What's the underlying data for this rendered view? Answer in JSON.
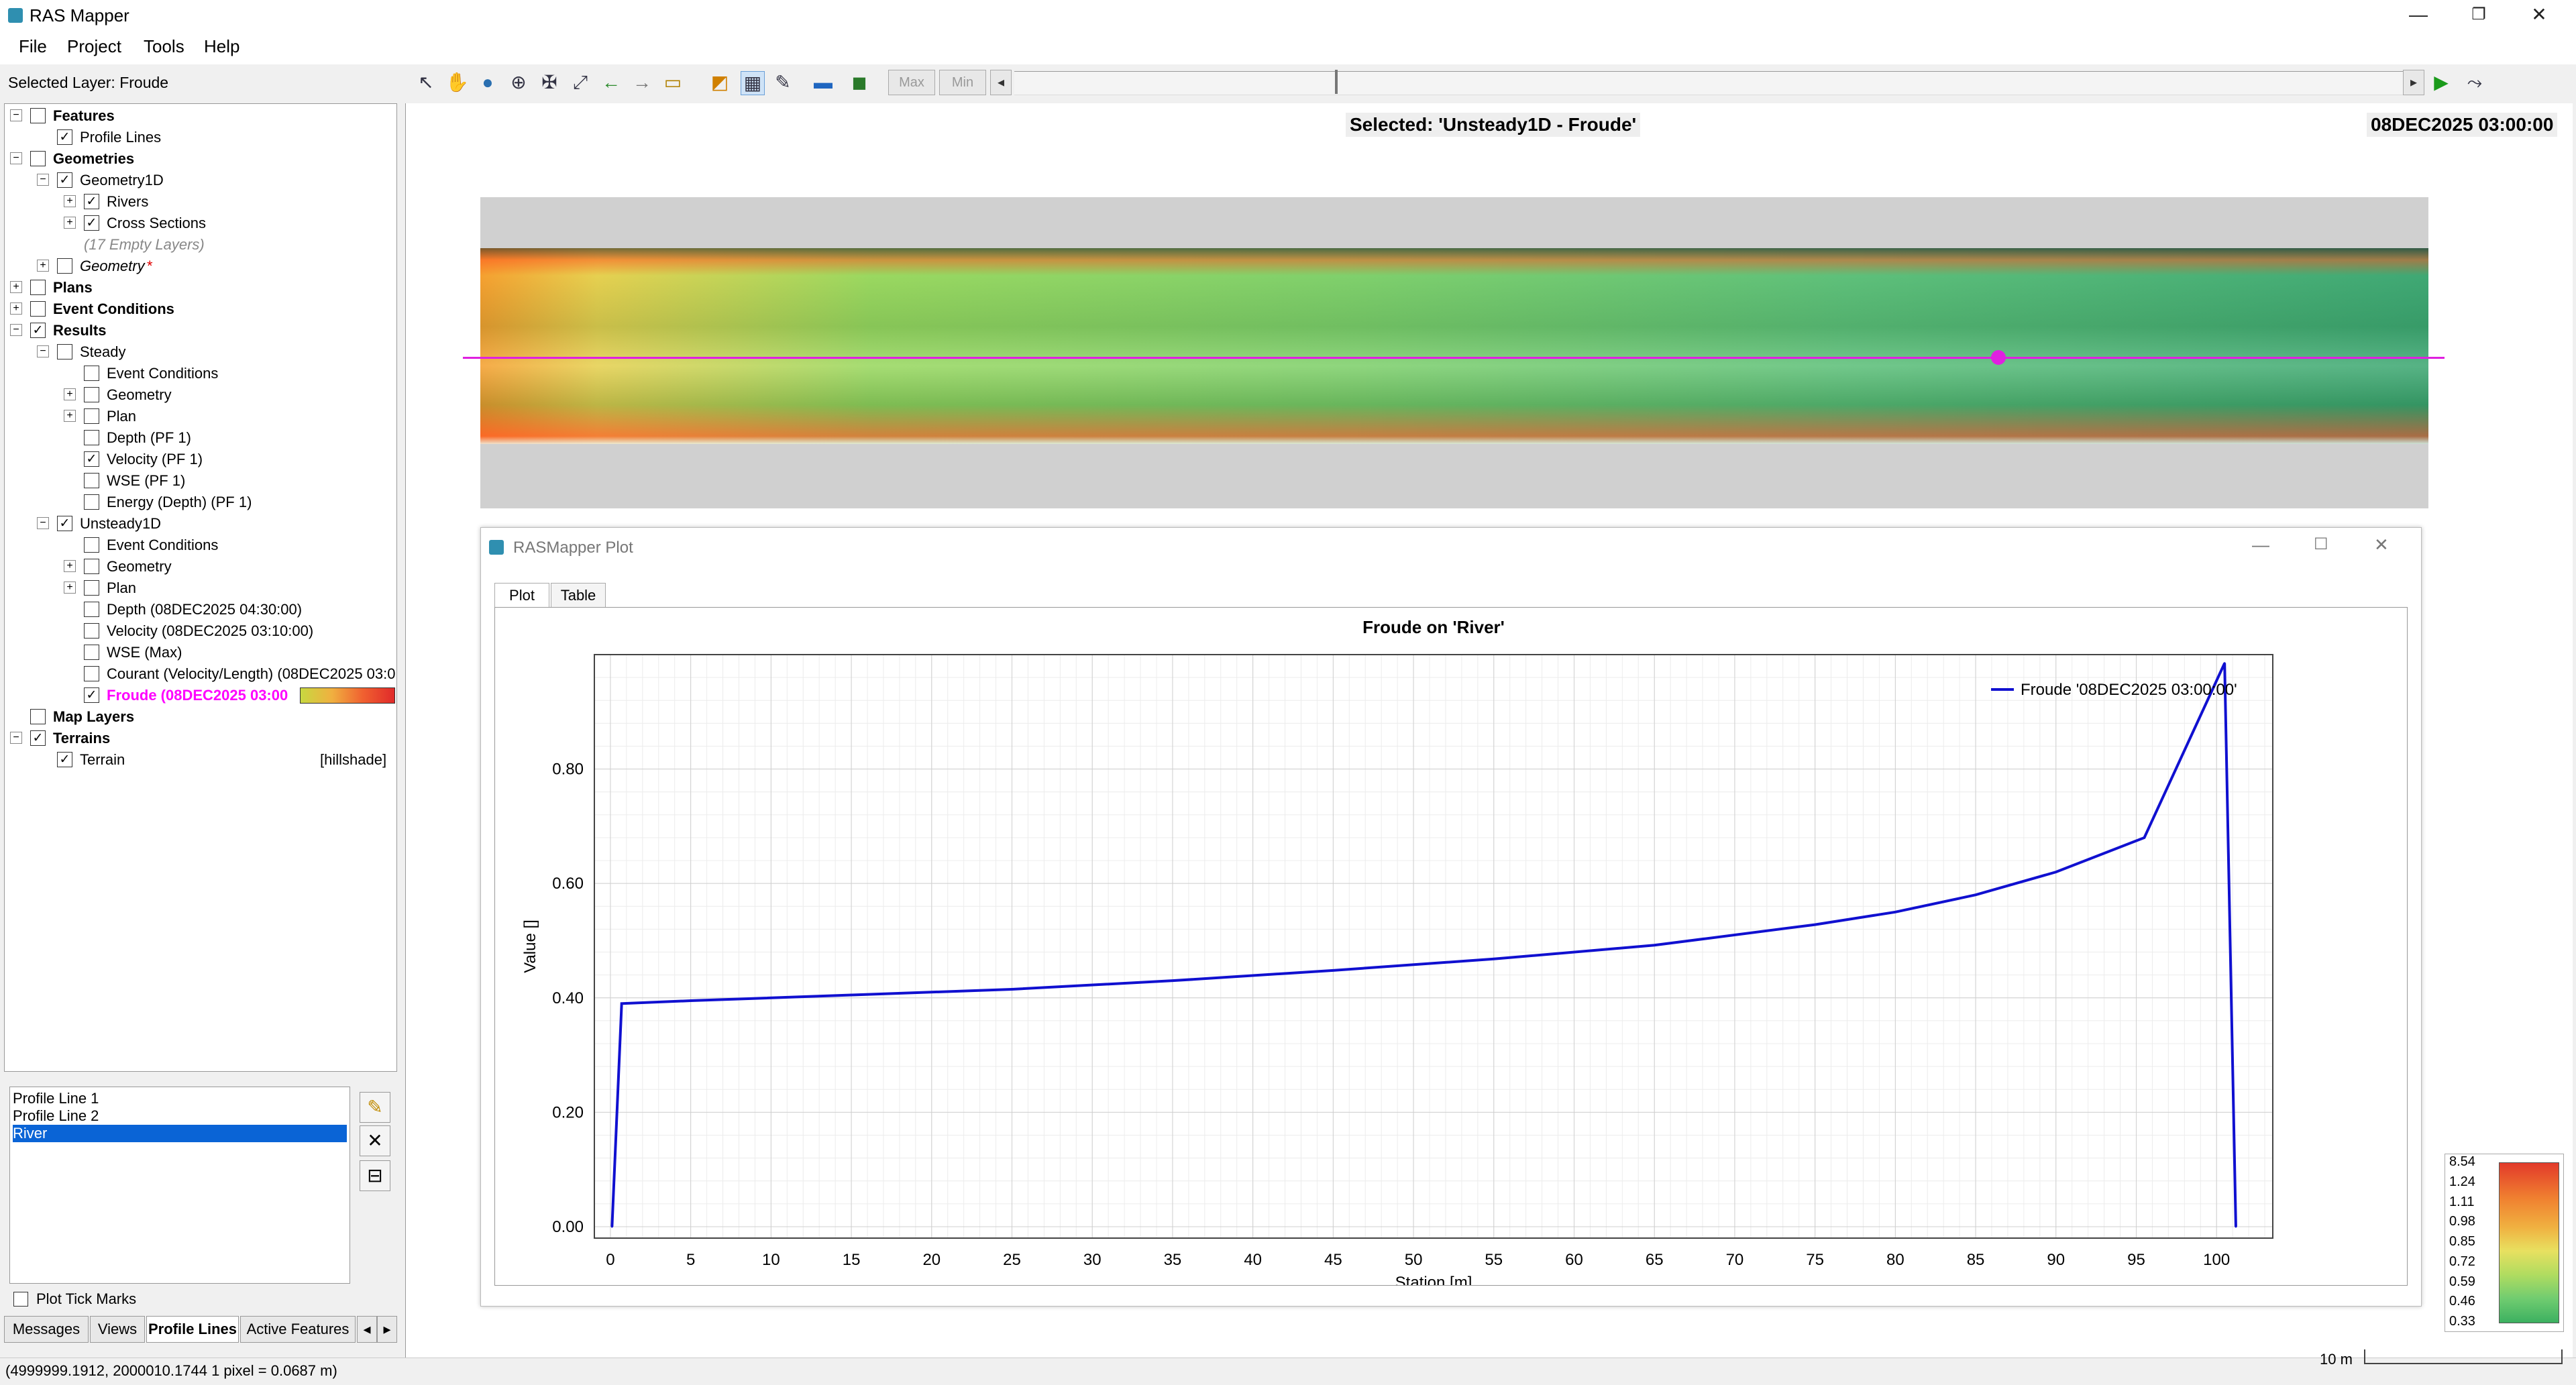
{
  "window": {
    "title": "RAS Mapper"
  },
  "menu": [
    "File",
    "Project",
    "Tools",
    "Help"
  ],
  "toolbar": {
    "selected_layer": "Selected Layer: Froude",
    "max_label": "Max",
    "min_label": "Min"
  },
  "tree": [
    {
      "label": "Features",
      "indent": 0,
      "expander": "−",
      "checked": false,
      "style": "bold"
    },
    {
      "label": "Profile Lines",
      "indent": 1,
      "expander": "",
      "checked": true,
      "style": ""
    },
    {
      "label": "Geometries",
      "indent": 0,
      "expander": "−",
      "checked": false,
      "style": "bold"
    },
    {
      "label": "Geometry1D",
      "indent": 1,
      "expander": "−",
      "checked": true,
      "style": ""
    },
    {
      "label": "Rivers",
      "indent": 2,
      "expander": "+",
      "checked": true,
      "style": ""
    },
    {
      "label": "Cross Sections",
      "indent": 2,
      "expander": "+",
      "checked": true,
      "style": ""
    },
    {
      "label": "(17 Empty Layers)",
      "indent": 2,
      "expander": "",
      "checked": null,
      "style": "italic gray"
    },
    {
      "label": "Geometry",
      "indent": 1,
      "expander": "+",
      "checked": false,
      "style": "italic"
    },
    {
      "label": "Plans",
      "indent": 0,
      "expander": "+",
      "checked": false,
      "style": "bold"
    },
    {
      "label": "Event Conditions",
      "indent": 0,
      "expander": "+",
      "checked": false,
      "style": "bold"
    },
    {
      "label": "Results",
      "indent": 0,
      "expander": "−",
      "checked": true,
      "style": "bold"
    },
    {
      "label": "Steady",
      "indent": 1,
      "expander": "−",
      "checked": false,
      "style": ""
    },
    {
      "label": "Event Conditions",
      "indent": 2,
      "expander": "",
      "checked": false,
      "style": ""
    },
    {
      "label": "Geometry",
      "indent": 2,
      "expander": "+",
      "checked": false,
      "style": ""
    },
    {
      "label": "Plan",
      "indent": 2,
      "expander": "+",
      "checked": false,
      "style": ""
    },
    {
      "label": "Depth (PF 1)",
      "indent": 2,
      "expander": "",
      "checked": false,
      "style": ""
    },
    {
      "label": "Velocity (PF 1)",
      "indent": 2,
      "expander": "",
      "checked": true,
      "style": ""
    },
    {
      "label": "WSE (PF 1)",
      "indent": 2,
      "expander": "",
      "checked": false,
      "style": ""
    },
    {
      "label": "Energy (Depth) (PF 1)",
      "indent": 2,
      "expander": "",
      "checked": false,
      "style": ""
    },
    {
      "label": "Unsteady1D",
      "indent": 1,
      "expander": "−",
      "checked": true,
      "style": ""
    },
    {
      "label": "Event Conditions",
      "indent": 2,
      "expander": "",
      "checked": false,
      "style": ""
    },
    {
      "label": "Geometry",
      "indent": 2,
      "expander": "+",
      "checked": false,
      "style": ""
    },
    {
      "label": "Plan",
      "indent": 2,
      "expander": "+",
      "checked": false,
      "style": ""
    },
    {
      "label": "Depth (08DEC2025 04:30:00)",
      "indent": 2,
      "expander": "",
      "checked": false,
      "style": ""
    },
    {
      "label": "Velocity (08DEC2025 03:10:00)",
      "indent": 2,
      "expander": "",
      "checked": false,
      "style": ""
    },
    {
      "label": "WSE (Max)",
      "indent": 2,
      "expander": "",
      "checked": false,
      "style": ""
    },
    {
      "label": "Courant (Velocity/Length) (08DEC2025 03:0",
      "indent": 2,
      "expander": "",
      "checked": false,
      "style": ""
    },
    {
      "label": "Froude (08DEC2025 03:00",
      "indent": 2,
      "expander": "",
      "checked": true,
      "style": "selected"
    },
    {
      "label": "Map Layers",
      "indent": 0,
      "expander": "",
      "checked": false,
      "style": "bold"
    },
    {
      "label": "Terrains",
      "indent": 0,
      "expander": "−",
      "checked": true,
      "style": "bold"
    },
    {
      "label": "Terrain",
      "indent": 1,
      "expander": "",
      "checked": true,
      "style": "",
      "suffix": "[hillshade]"
    }
  ],
  "profile_lines": [
    "Profile Line 1",
    "Profile Line 2",
    "River"
  ],
  "plot_tick_marks": "Plot Tick Marks",
  "bottom_tabs": [
    "Messages",
    "Views",
    "Profile Lines",
    "Active Features"
  ],
  "status": "(4999999.1912, 2000010.1744  1 pixel = 0.0687 m)",
  "map": {
    "selected_title": "Selected: 'Unsteady1D - Froude'",
    "time": "08DEC2025 03:00:00",
    "scale_label": "10 m"
  },
  "plot_window": {
    "title": "RASMapper Plot",
    "tabs": [
      "Plot",
      "Table"
    ]
  },
  "legend": {
    "values": [
      "8.54",
      "1.24",
      "1.11",
      "0.98",
      "0.85",
      "0.72",
      "0.59",
      "0.46",
      "0.33"
    ]
  },
  "colors": {
    "line": "#1010d0",
    "selected_layer": "#ff00ff",
    "profile_line": "#e020e0",
    "selection": "#0a64d6"
  },
  "chart_data": {
    "type": "line",
    "title": "Froude on 'River'",
    "xlabel": "Station [m]",
    "ylabel": "Value []",
    "xlim": [
      -1,
      103.5
    ],
    "ylim": [
      -0.02,
      1.0
    ],
    "xticks": [
      0,
      5,
      10,
      15,
      20,
      25,
      30,
      35,
      40,
      45,
      50,
      55,
      60,
      65,
      70,
      75,
      80,
      85,
      90,
      95,
      100
    ],
    "yticks": [
      0.0,
      0.2,
      0.4,
      0.6,
      0.8
    ],
    "ytick_labels": [
      "0.00",
      "0.20",
      "0.40",
      "0.60",
      "0.80"
    ],
    "grid": true,
    "legend_position": "top-right",
    "series": [
      {
        "name": "Froude '08DEC2025 03:00:00'",
        "x": [
          0.1,
          0.7,
          5,
          15,
          25,
          35,
          45,
          55,
          65,
          75,
          80,
          85,
          90,
          95.5,
          100.5,
          101.2
        ],
        "y": [
          0.0,
          0.39,
          0.395,
          0.405,
          0.415,
          0.43,
          0.448,
          0.468,
          0.492,
          0.528,
          0.55,
          0.58,
          0.62,
          0.68,
          0.985,
          0.0
        ]
      }
    ]
  }
}
